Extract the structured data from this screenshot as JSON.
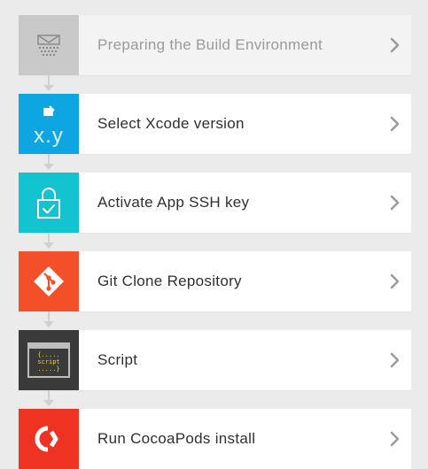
{
  "steps": [
    {
      "label": "Preparing the Build Environment",
      "icon": "build-environment-icon",
      "tile_color": "#c9c9c9"
    },
    {
      "label": "Select Xcode version",
      "icon": "xcode-version-icon",
      "tile_color": "#0ea5e3",
      "tile_text": "x.y"
    },
    {
      "label": "Activate App SSH key",
      "icon": "ssh-key-lock-icon",
      "tile_color": "#14c3d0"
    },
    {
      "label": "Git Clone Repository",
      "icon": "git-icon",
      "tile_color": "#f34f29"
    },
    {
      "label": "Script",
      "icon": "script-icon",
      "tile_color": "#3a3a3a",
      "tile_lines": [
        "{.....",
        "script",
        ".....}"
      ]
    },
    {
      "label": "Run CocoaPods install",
      "icon": "cocoapods-icon",
      "tile_color": "#ee3322"
    }
  ]
}
